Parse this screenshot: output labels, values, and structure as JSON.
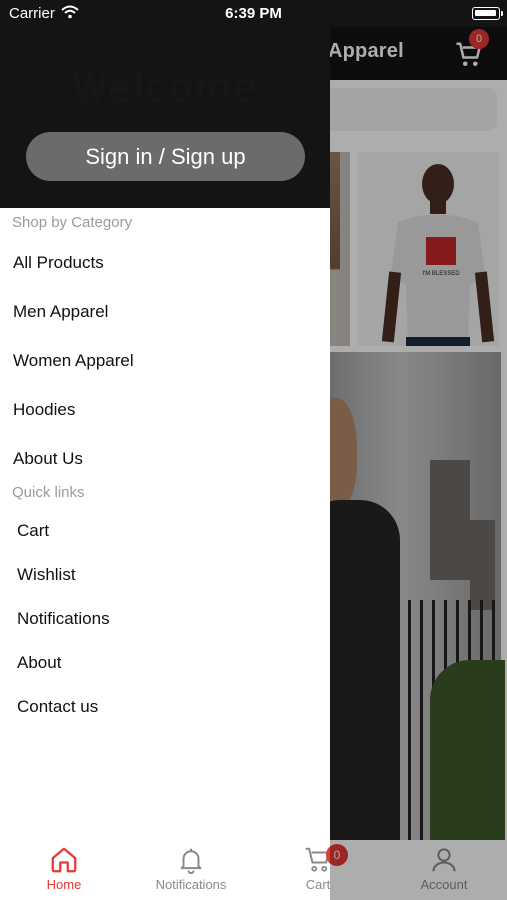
{
  "status_bar": {
    "carrier": "Carrier",
    "time": "6:39 PM"
  },
  "app": {
    "title": "Apparel",
    "cart_count": "0",
    "product_print": "I'M BLESSED"
  },
  "drawer": {
    "welcome": "Welcome",
    "sign_in_label": "Sign in / Sign up",
    "shop_by_category_label": "Shop by Category",
    "categories": [
      "All Products",
      "Men Apparel",
      "Women Apparel",
      "Hoodies",
      "About Us"
    ],
    "quick_links_label": "Quick links",
    "quick_links": [
      "Cart",
      "Wishlist",
      "Notifications",
      "About",
      "Contact us"
    ]
  },
  "tabs": {
    "home": "Home",
    "notifications": "Notifications",
    "cart": "Cart",
    "account": "Account",
    "cart_badge": "0"
  },
  "colors": {
    "accent": "#e53935",
    "header_bg": "#141414",
    "sign_in_bg": "#6b6b6b",
    "inactive_tab": "#8a8a8a"
  },
  "icons": {
    "home": "home-icon",
    "notifications": "bell-icon",
    "cart": "cart-icon",
    "account": "person-icon",
    "wifi": "wifi-icon",
    "battery": "battery-icon"
  }
}
